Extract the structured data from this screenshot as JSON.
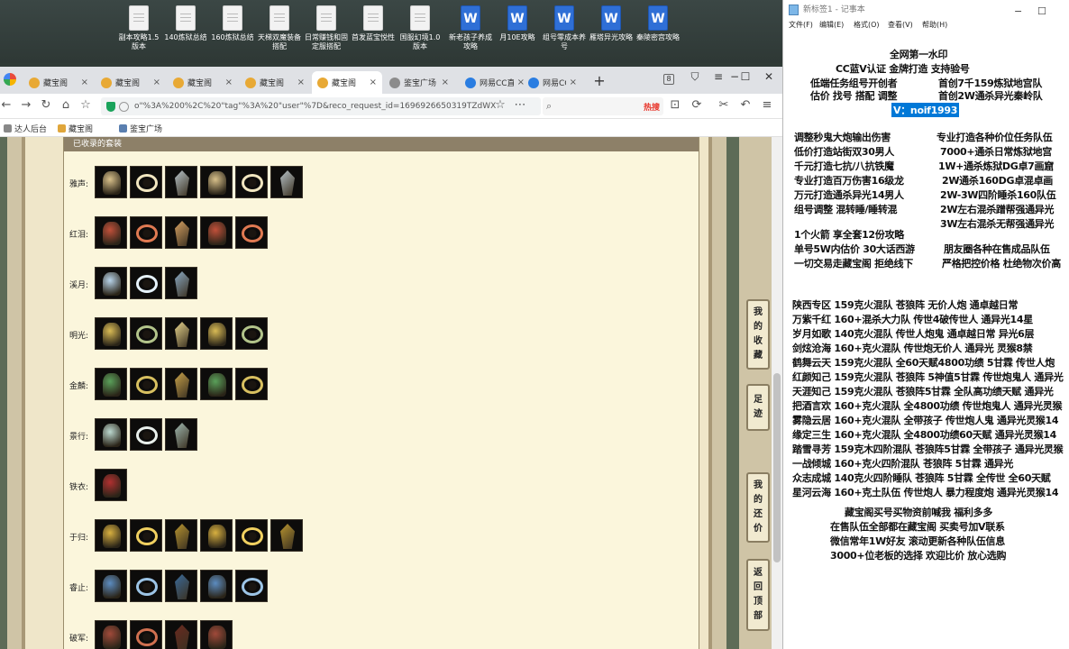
{
  "desktop": {
    "icons": [
      {
        "label": "副本攻略1.5版本",
        "kind": "doc"
      },
      {
        "label": "140炼狱总结",
        "kind": "doc"
      },
      {
        "label": "160炼狱总结",
        "kind": "doc"
      },
      {
        "label": "天梯双魔装备搭配",
        "kind": "doc"
      },
      {
        "label": "日常赚钱和固定服搭配",
        "kind": "doc"
      },
      {
        "label": "首发蓝宝悦性",
        "kind": "doc"
      },
      {
        "label": "国服幻境1.0版本",
        "kind": "doc"
      },
      {
        "label": "新老孩子养成攻略",
        "kind": "wps"
      },
      {
        "label": "月10E攻略",
        "kind": "wps"
      },
      {
        "label": "组号零成本养号",
        "kind": "wps"
      },
      {
        "label": "雁塔异光攻略",
        "kind": "wps"
      },
      {
        "label": "秦陵密宫攻略",
        "kind": "wps"
      }
    ]
  },
  "browser": {
    "tabs": [
      {
        "label": "藏宝阁",
        "active": false,
        "icon": "cbg-icon"
      },
      {
        "label": "藏宝阁",
        "active": false,
        "icon": "cbg-icon"
      },
      {
        "label": "藏宝阁",
        "active": false,
        "icon": "cbg-icon"
      },
      {
        "label": "藏宝阁",
        "active": false,
        "icon": "cbg-icon"
      },
      {
        "label": "藏宝阁",
        "active": true,
        "icon": "cbg-icon"
      },
      {
        "label": "鉴宝广场",
        "active": false,
        "icon": "globe-icon"
      },
      {
        "label": "网易CC直播",
        "active": false,
        "icon": "cc-icon"
      },
      {
        "label": "网易CC",
        "active": false,
        "icon": "cc-icon"
      }
    ],
    "tab_count": "8",
    "url": "o\"%3A%200%2C%20\"tag\"%3A%20\"user\"%7D&reco_request_id=1696926650319TZdWX",
    "search_hot": "热搜",
    "bookmarks": [
      {
        "label": "达人后台",
        "color": "#888888"
      },
      {
        "label": "藏宝阁",
        "color": "#e0a63b"
      },
      {
        "label": "鉴宝广场",
        "color": "#5a7fb0"
      }
    ]
  },
  "page": {
    "section_title": "已收录的套装",
    "sets": [
      {
        "label": "雅声:",
        "count": 6
      },
      {
        "label": "红泪:",
        "count": 5
      },
      {
        "label": "溪月:",
        "count": 3
      },
      {
        "label": "明光:",
        "count": 5
      },
      {
        "label": "金麟:",
        "count": 5
      },
      {
        "label": "景行:",
        "count": 3
      },
      {
        "label": "铁衣:",
        "count": 1
      },
      {
        "label": "于归:",
        "count": 6
      },
      {
        "label": "睿止:",
        "count": 5
      },
      {
        "label": "破军:",
        "count": 4
      }
    ],
    "side_buttons": [
      {
        "chars": [
          "我",
          "的",
          "收",
          "藏"
        ]
      },
      {
        "chars": [
          "足",
          "迹"
        ]
      },
      {
        "chars": [
          "我",
          "的",
          "还",
          "价"
        ]
      },
      {
        "chars": [
          "返",
          "回",
          "顶",
          "部"
        ]
      }
    ]
  },
  "notepad": {
    "title": "新标签1 - 记事本",
    "menu": [
      "文件(F)",
      "编辑(E)",
      "格式(O)",
      "查看(V)",
      "帮助(H)"
    ],
    "lines": [
      "全网第一水印",
      "CC蓝V认证 金牌打造 支持验号",
      "低端任务组号开创者",
      "首创7千159炼狱地宫队",
      "估价 找号 搭配 调整",
      "首创2W通杀异光秦岭队",
      "V：noif1993",
      "调整秒鬼大炮输出伤害",
      "专业打造各种价位任务队伍",
      "低价打造站街双30男人",
      "7000+通杀日常炼狱地宫",
      "千元打造七抗/八抗铁魔",
      "1W+通杀炼狱DG卓7画窟",
      "专业打造百万伤害16级龙",
      "2W通杀160DG卓混卓画",
      "万元打造通杀异光14男人",
      "2W-3W四阶睡杀160队伍",
      "组号调整 混转睡/睡转混",
      "2W左右混杀蹭帮强通异光",
      "3W左右混杀无帮强通异光",
      "1个火箭 享全套12份攻略",
      "单号5W内估价 30大话西游",
      "朋友圈各种在售成品队伍",
      "一切交易走藏宝阁 拒绝线下",
      "严格把控价格 杜绝物次价高",
      "陕西专区 159克火混队 苍狼阵 无价人炮 通卓越日常",
      "万紫千红 160+混杀大力队 传世4破传世人 通异光14星",
      "岁月如歌 140克火混队 传世人炮鬼 通卓越日常 异光6层",
      "剑炫沧海 160+克火混队 传世炮无价人 通异光 灵猴8禁",
      "鹤舞云天 159克火混队 全60天赋4800功绩 5甘霖 传世人炮",
      "红颜知己 159克火混队 苍狼阵 5神值5甘霖 传世炮鬼人 通异光",
      "天涯知己 159克火混队 苍狼阵5甘霖 全队高功绩天赋 通异光",
      "把酒言欢 160+克火混队 全4800功绩 传世炮鬼人 通异光灵猴",
      "雾隐云居 160+克火混队 全带孩子 传世炮人鬼 通异光灵猴14",
      "缘定三生 160+克火混队 全4800功绩60天赋 通异光灵猴14",
      "踏雪寻芳 159克木四阶混队 苍狼阵5甘霖 全带孩子 通异光灵猴",
      "一战倾城 160+克火四阶混队 苍狼阵 5甘霖 通异光",
      "众志成城 140克火四阶睡队 苍狼阵 5甘霖 全传世 全60天赋",
      "星河云海 160+克土队伍 传世炮人 暴力程度炮 通异光灵猴14",
      "藏宝阁买号买物资前喊我 福利多多",
      "在售队伍全部都在藏宝阁 买卖号加V联系",
      "微信常年1W好友 滚动更新各种队伍信息",
      "3000+位老板的选择 欢迎比价 放心选购"
    ]
  }
}
